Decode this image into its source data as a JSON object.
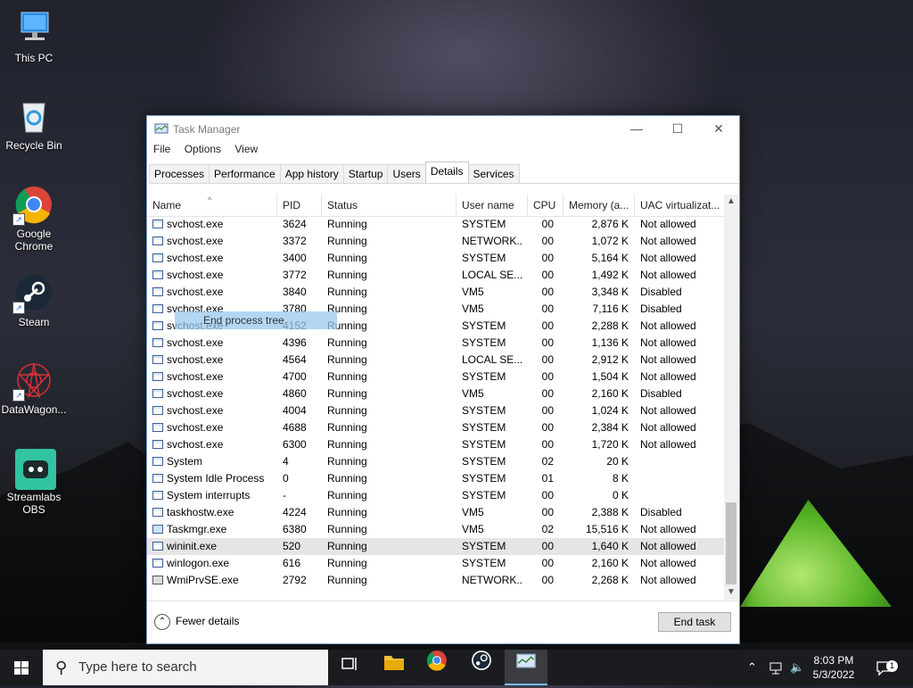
{
  "desktop": {
    "icons": [
      {
        "label": "This PC"
      },
      {
        "label": "Recycle Bin"
      },
      {
        "label": "Google Chrome"
      },
      {
        "label": "Steam"
      },
      {
        "label": "DataWagon..."
      },
      {
        "label": "Streamlabs OBS"
      }
    ]
  },
  "window": {
    "title": "Task Manager",
    "menu": [
      "File",
      "Options",
      "View"
    ],
    "tabs": [
      "Processes",
      "Performance",
      "App history",
      "Startup",
      "Users",
      "Details",
      "Services"
    ],
    "active_tab": "Details",
    "columns": [
      "Name",
      "PID",
      "Status",
      "User name",
      "CPU",
      "Memory (a...",
      "UAC virtualizat..."
    ],
    "rows": [
      {
        "name": "svchost.exe",
        "pid": "3624",
        "status": "Running",
        "user": "SYSTEM",
        "cpu": "00",
        "mem": "2,876 K",
        "uac": "Not allowed"
      },
      {
        "name": "svchost.exe",
        "pid": "3372",
        "status": "Running",
        "user": "NETWORK...",
        "cpu": "00",
        "mem": "1,072 K",
        "uac": "Not allowed"
      },
      {
        "name": "svchost.exe",
        "pid": "3400",
        "status": "Running",
        "user": "SYSTEM",
        "cpu": "00",
        "mem": "5,164 K",
        "uac": "Not allowed"
      },
      {
        "name": "svchost.exe",
        "pid": "3772",
        "status": "Running",
        "user": "LOCAL SE...",
        "cpu": "00",
        "mem": "1,492 K",
        "uac": "Not allowed"
      },
      {
        "name": "svchost.exe",
        "pid": "3840",
        "status": "Running",
        "user": "VM5",
        "cpu": "00",
        "mem": "3,348 K",
        "uac": "Disabled"
      },
      {
        "name": "svchost.exe",
        "pid": "3780",
        "status": "Running",
        "user": "VM5",
        "cpu": "00",
        "mem": "7,116 K",
        "uac": "Disabled"
      },
      {
        "name": "svchost.exe",
        "pid": "4152",
        "status": "Running",
        "user": "SYSTEM",
        "cpu": "00",
        "mem": "2,288 K",
        "uac": "Not allowed"
      },
      {
        "name": "svchost.exe",
        "pid": "4396",
        "status": "Running",
        "user": "SYSTEM",
        "cpu": "00",
        "mem": "1,136 K",
        "uac": "Not allowed"
      },
      {
        "name": "svchost.exe",
        "pid": "4564",
        "status": "Running",
        "user": "LOCAL SE...",
        "cpu": "00",
        "mem": "2,912 K",
        "uac": "Not allowed"
      },
      {
        "name": "svchost.exe",
        "pid": "4700",
        "status": "Running",
        "user": "SYSTEM",
        "cpu": "00",
        "mem": "1,504 K",
        "uac": "Not allowed"
      },
      {
        "name": "svchost.exe",
        "pid": "4860",
        "status": "Running",
        "user": "VM5",
        "cpu": "00",
        "mem": "2,160 K",
        "uac": "Disabled"
      },
      {
        "name": "svchost.exe",
        "pid": "4004",
        "status": "Running",
        "user": "SYSTEM",
        "cpu": "00",
        "mem": "1,024 K",
        "uac": "Not allowed"
      },
      {
        "name": "svchost.exe",
        "pid": "4688",
        "status": "Running",
        "user": "SYSTEM",
        "cpu": "00",
        "mem": "2,384 K",
        "uac": "Not allowed"
      },
      {
        "name": "svchost.exe",
        "pid": "6300",
        "status": "Running",
        "user": "SYSTEM",
        "cpu": "00",
        "mem": "1,720 K",
        "uac": "Not allowed"
      },
      {
        "name": "System",
        "pid": "4",
        "status": "Running",
        "user": "SYSTEM",
        "cpu": "02",
        "mem": "20 K",
        "uac": ""
      },
      {
        "name": "System Idle Process",
        "pid": "0",
        "status": "Running",
        "user": "SYSTEM",
        "cpu": "01",
        "mem": "8 K",
        "uac": ""
      },
      {
        "name": "System interrupts",
        "pid": "-",
        "status": "Running",
        "user": "SYSTEM",
        "cpu": "00",
        "mem": "0 K",
        "uac": ""
      },
      {
        "name": "taskhostw.exe",
        "pid": "4224",
        "status": "Running",
        "user": "VM5",
        "cpu": "00",
        "mem": "2,388 K",
        "uac": "Disabled"
      },
      {
        "name": "Taskmgr.exe",
        "pid": "6380",
        "status": "Running",
        "user": "VM5",
        "cpu": "02",
        "mem": "15,516 K",
        "uac": "Not allowed"
      },
      {
        "name": "wininit.exe",
        "pid": "520",
        "status": "Running",
        "user": "SYSTEM",
        "cpu": "00",
        "mem": "1,640 K",
        "uac": "Not allowed",
        "selected": true
      },
      {
        "name": "winlogon.exe",
        "pid": "616",
        "status": "Running",
        "user": "SYSTEM",
        "cpu": "00",
        "mem": "2,160 K",
        "uac": "Not allowed"
      },
      {
        "name": "WmiPrvSE.exe",
        "pid": "2792",
        "status": "Running",
        "user": "NETWORK...",
        "cpu": "00",
        "mem": "2,268 K",
        "uac": "Not allowed"
      }
    ],
    "drag_label": "End process tree",
    "fewer_details": "Fewer details",
    "end_task": "End task"
  },
  "taskbar": {
    "search_placeholder": "Type here to search",
    "time": "8:03 PM",
    "date": "5/3/2022",
    "notification_count": "1"
  },
  "colors": {
    "accent": "#76b9ed",
    "selection": "#e5e5e5",
    "drag_highlight": "#99c9ef"
  }
}
